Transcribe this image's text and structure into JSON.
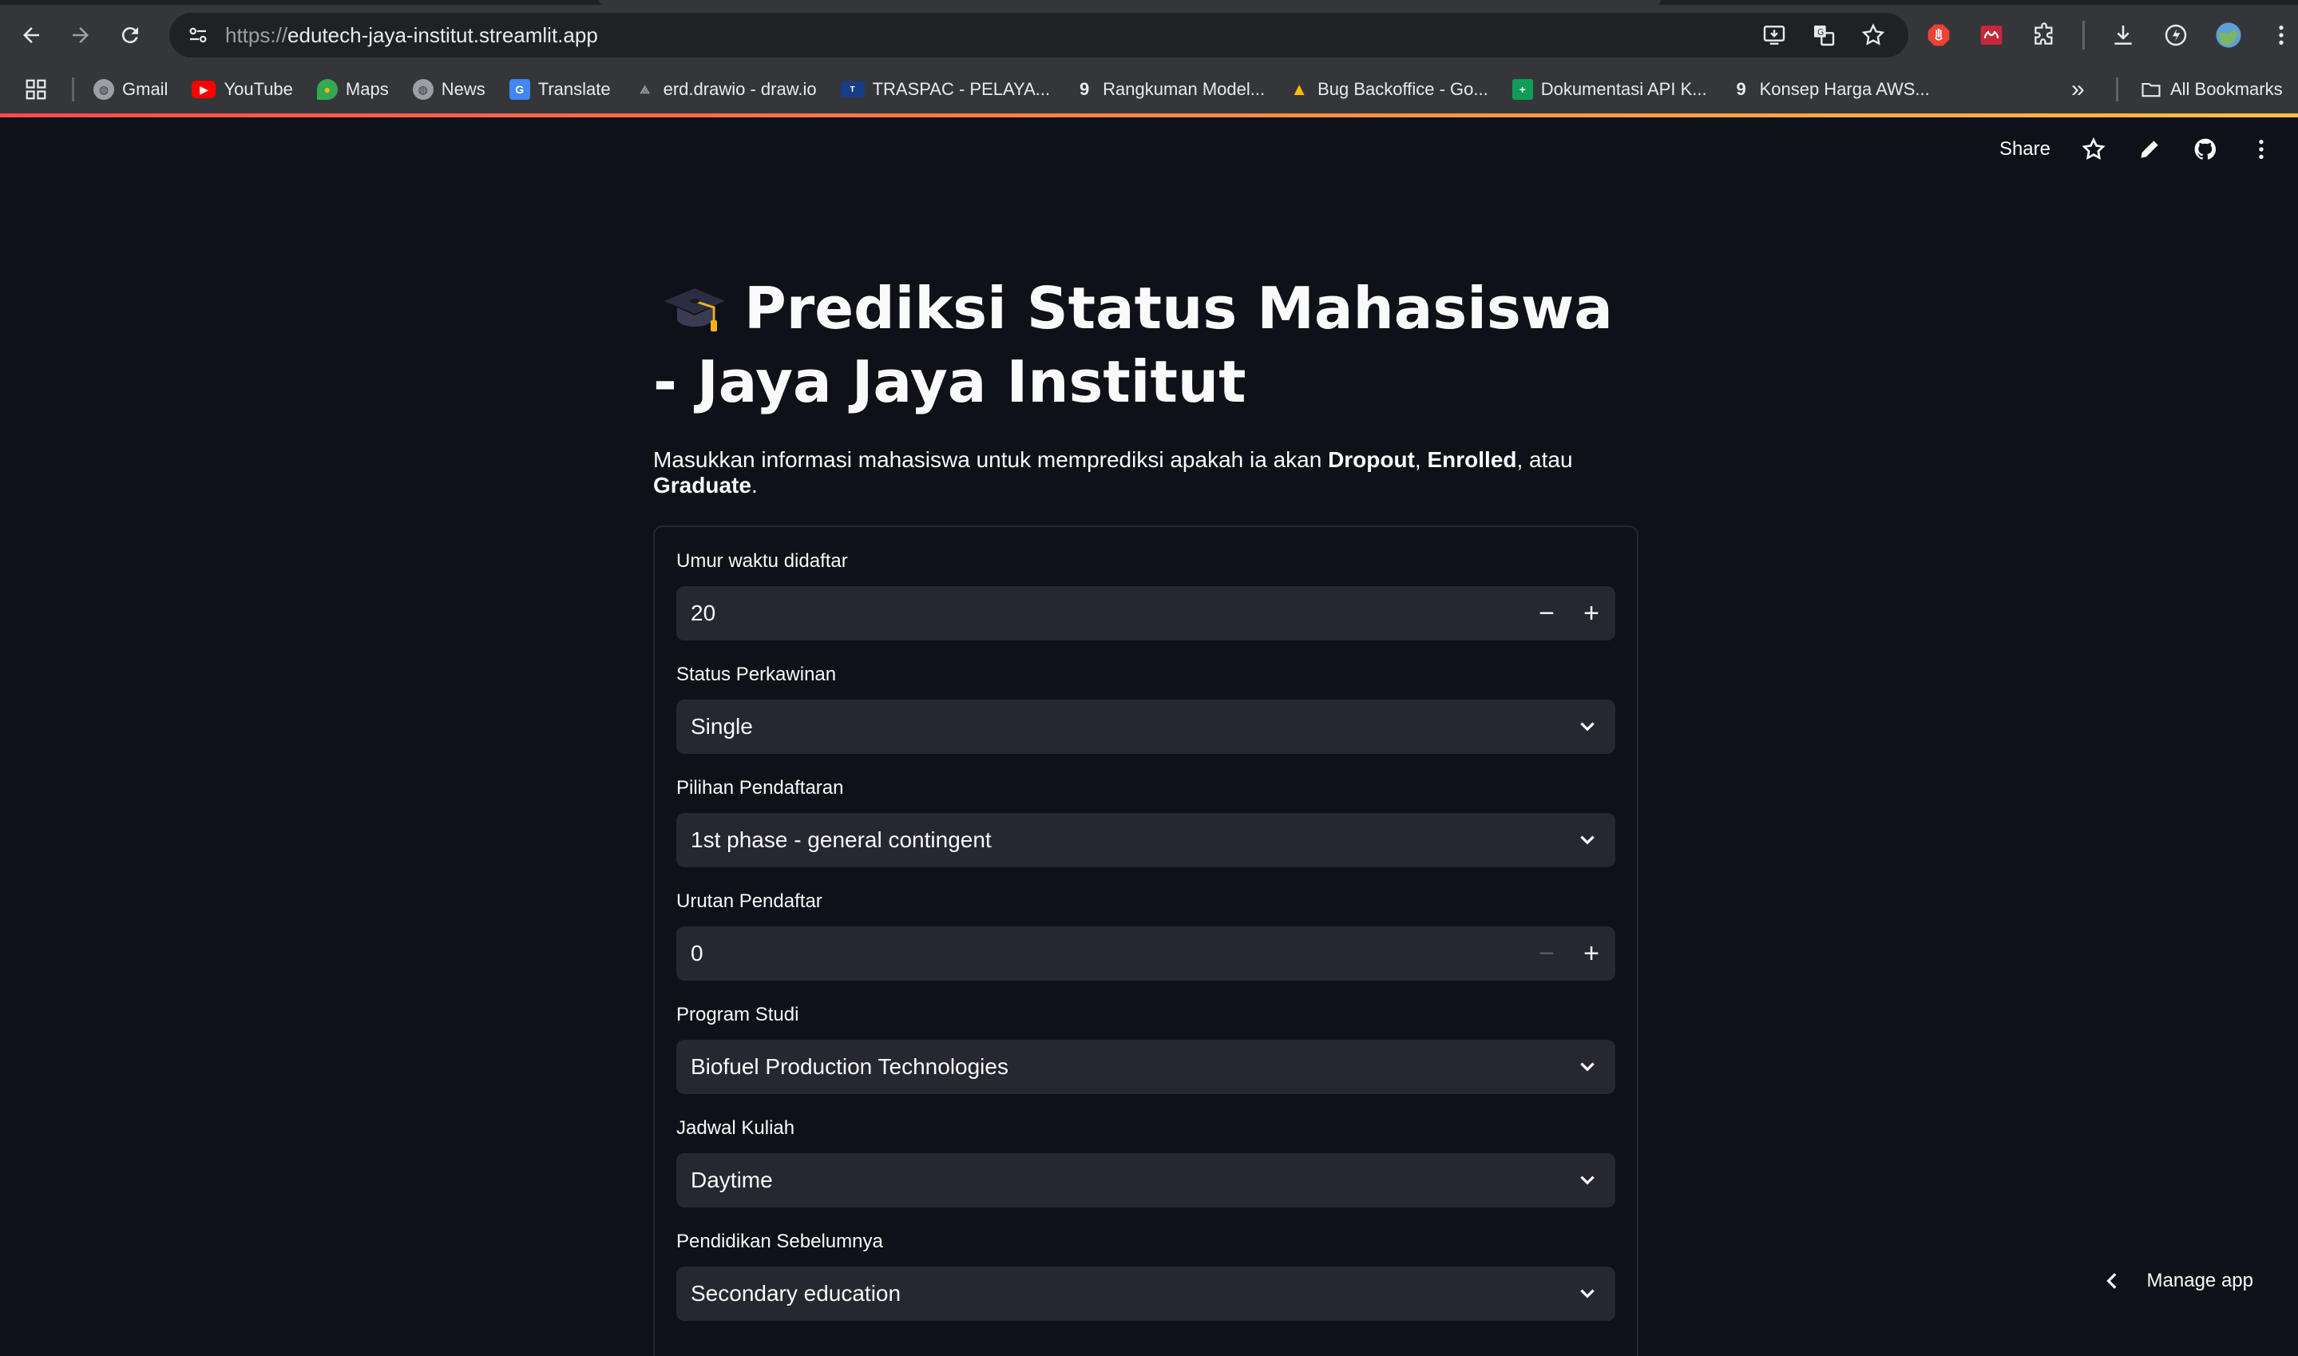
{
  "browser": {
    "url_scheme": "https://",
    "url_host": "edutech-jaya-institut.streamlit.app",
    "bookmarks": [
      {
        "label": "Gmail",
        "icon": "globe-icon"
      },
      {
        "label": "YouTube",
        "icon": "youtube-icon"
      },
      {
        "label": "Maps",
        "icon": "maps-icon"
      },
      {
        "label": "News",
        "icon": "globe-icon"
      },
      {
        "label": "Translate",
        "icon": "translate-icon"
      },
      {
        "label": "erd.drawio - draw.io",
        "icon": "drawio-icon"
      },
      {
        "label": "TRASPAC - PELAYA...",
        "icon": "traspac-icon"
      },
      {
        "label": "Rangkuman Model...",
        "icon": "notion-icon"
      },
      {
        "label": "Bug Backoffice - Go...",
        "icon": "drive-icon"
      },
      {
        "label": "Dokumentasi API K...",
        "icon": "sheets-icon"
      },
      {
        "label": "Konsep Harga AWS...",
        "icon": "notion-icon"
      }
    ],
    "all_bookmarks_label": "All Bookmarks"
  },
  "st_header": {
    "share_label": "Share"
  },
  "main": {
    "title": "Prediksi Status Mahasiswa - Jaya Jaya Institut",
    "subtitle_prefix": "Masukkan informasi mahasiswa untuk memprediksi apakah ia akan ",
    "subtitle_opt1": "Dropout",
    "subtitle_sep1": ", ",
    "subtitle_opt2": "Enrolled",
    "subtitle_sep2": ", atau ",
    "subtitle_opt3": "Graduate",
    "subtitle_suffix": "."
  },
  "form": {
    "fields": [
      {
        "label": "Umur waktu didaftar",
        "type": "number",
        "value": "20"
      },
      {
        "label": "Status Perkawinan",
        "type": "select",
        "value": "Single"
      },
      {
        "label": "Pilihan Pendaftaran",
        "type": "select",
        "value": "1st phase - general contingent"
      },
      {
        "label": "Urutan Pendaftar",
        "type": "number",
        "value": "0"
      },
      {
        "label": "Program Studi",
        "type": "select",
        "value": "Biofuel Production Technologies"
      },
      {
        "label": "Jadwal Kuliah",
        "type": "select",
        "value": "Daytime"
      },
      {
        "label": "Pendidikan Sebelumnya",
        "type": "select",
        "value": "Secondary education"
      }
    ]
  },
  "footer": {
    "manage_app_label": "Manage app"
  },
  "colors": {
    "background": "#0e1117",
    "widget": "#262730",
    "accent": "#ff4b4b"
  }
}
